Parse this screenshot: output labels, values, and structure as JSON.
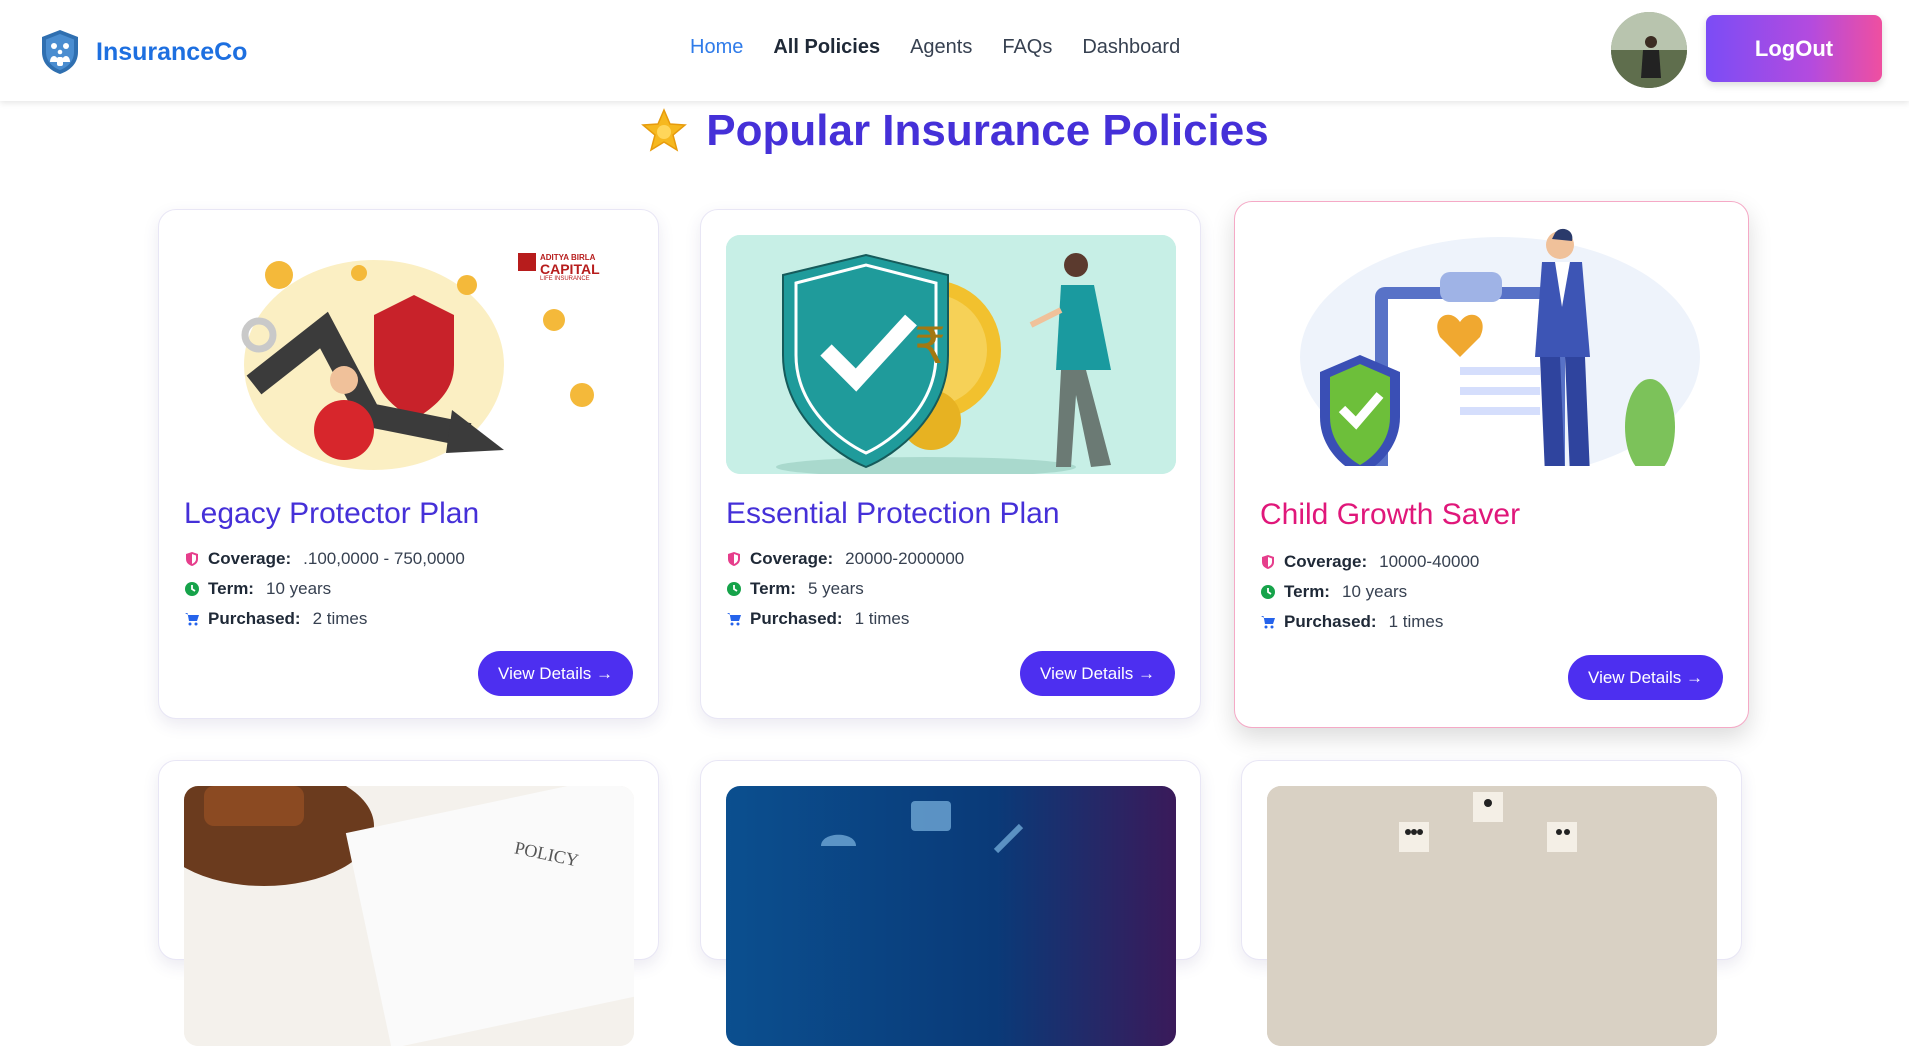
{
  "nav": {
    "brand": "InsuranceCo",
    "links": [
      {
        "label": "Home"
      },
      {
        "label": "All Policies"
      },
      {
        "label": "Agents"
      },
      {
        "label": "FAQs"
      },
      {
        "label": "Dashboard"
      }
    ],
    "logout": "LogOut"
  },
  "heading": {
    "icon": "star-icon",
    "title": "Popular Insurance Policies"
  },
  "labels": {
    "coverage": "Coverage:",
    "term": "Term:",
    "purchased": "Purchased:"
  },
  "policies": [
    {
      "title": "Legacy Protector Plan",
      "coverage": ".100,0000 - 750,0000",
      "term": "10 years",
      "purchased": "2 times",
      "button": "View Details →",
      "image_text": [
        "ADITYA BIRLA",
        "CAPITAL",
        "LIFE INSURANCE"
      ]
    },
    {
      "title": "Essential Protection Plan",
      "coverage": "20000-2000000",
      "term": "5 years",
      "purchased": "1 times",
      "button": "View Details →",
      "image_text": [
        "₹"
      ]
    },
    {
      "title": "Child Growth Saver",
      "coverage": "10000-40000",
      "term": "10 years",
      "purchased": "1 times",
      "button": "View Details →"
    }
  ],
  "row2_images": [
    {
      "image_text": "POLICY"
    },
    {
      "image_text": ""
    },
    {
      "image_text": ""
    }
  ],
  "colors": {
    "brand_blue": "#1d6fe0",
    "heading": "#4530d8",
    "highlight_title": "#e0177a",
    "button": "#4d2ff0",
    "logout_start": "#7b4cf6",
    "logout_end": "#ef4fa0"
  }
}
